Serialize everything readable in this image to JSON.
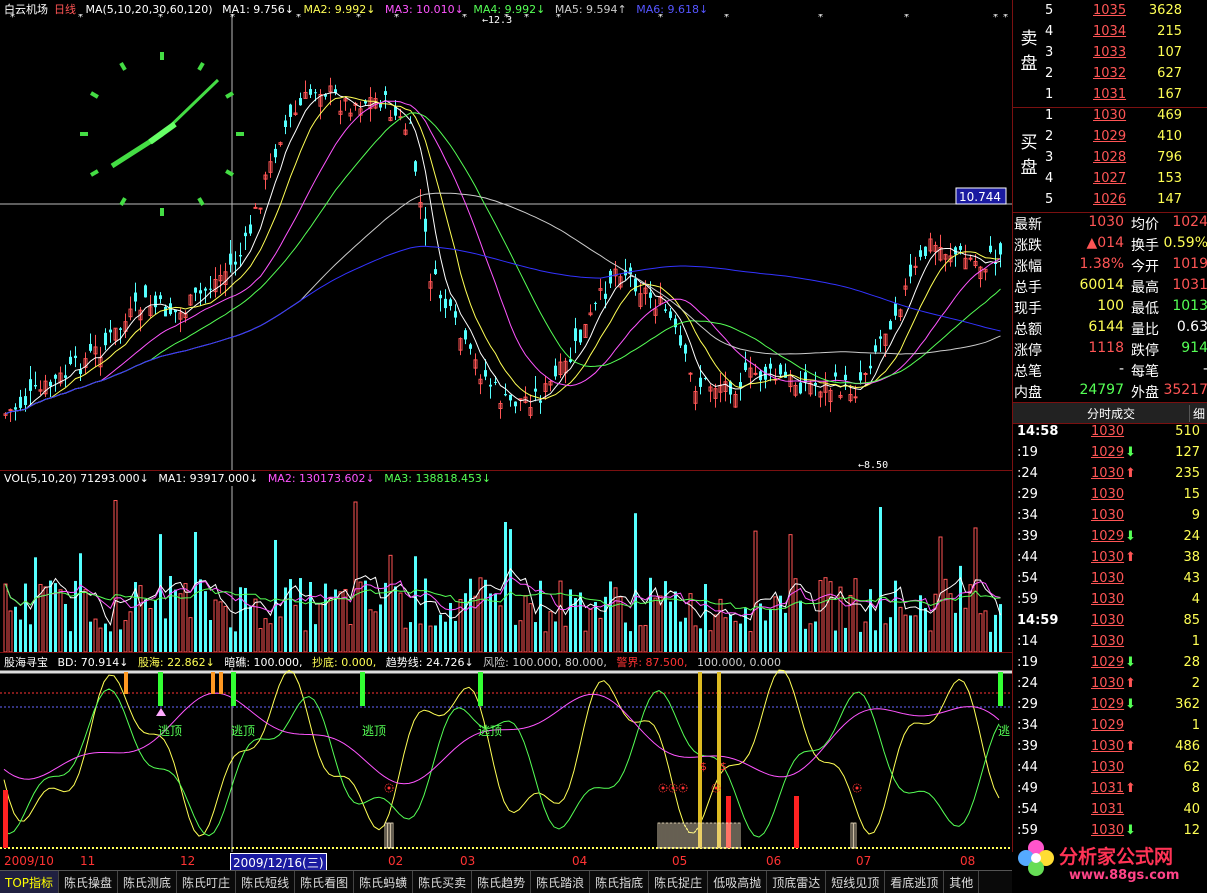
{
  "stock": {
    "name": "白云机场",
    "period": "日线"
  },
  "ma_header": {
    "prefix": "MA(5,10,20,30,60,120)",
    "ma1": "MA1: 9.756↓",
    "ma2": "MA2: 9.992↓",
    "ma3": "MA3: 10.010↓",
    "ma4": "MA4: 9.992↓",
    "ma5": "MA5: 9.594↑",
    "ma6": "MA6: 9.618↓"
  },
  "price_labels": {
    "high": "12.3",
    "low": "8.50",
    "cursor": "10.744"
  },
  "vol_header": {
    "prefix": "VOL(5,10,20) 71293.000↓",
    "ma1": "MA1: 93917.000↓",
    "ma2": "MA2: 130173.602↓",
    "ma3": "MA3: 138818.453↓"
  },
  "ind_header": {
    "name": "股海寻宝",
    "bd": "BD: 70.914↓",
    "gh": "股海: 22.862↓",
    "aj": "暗礁: 100.000,",
    "cd": "抄底: 0.000,",
    "qs": "趋势线: 24.726↓",
    "fx": "风险: 100.000, 80.000,",
    "jj": "警界: 87.500,",
    "rest": "100.000, 0.000"
  },
  "escape_labels": [
    "逃顶",
    "逃顶",
    "逃顶",
    "逃顶",
    "逃"
  ],
  "date_axis": [
    "2009/10",
    "11",
    "12",
    "02",
    "03",
    "04",
    "05",
    "06",
    "07",
    "08"
  ],
  "date_cursor": "2009/12/16(三)",
  "tabs": [
    "TOP指标",
    "陈氏操盘",
    "陈氏测底",
    "陈氏叮庄",
    "陈氏短线",
    "陈氏看图",
    "陈氏蚂蟥",
    "陈氏买卖",
    "陈氏趋势",
    "陈氏踏浪",
    "陈氏指底",
    "陈氏捉庄",
    "低吸高抛",
    "顶底雷达",
    "短线见顶",
    "看底逃顶",
    "其他"
  ],
  "orderbook": {
    "sell_side": "卖盘",
    "buy_side": "买盘",
    "sell": [
      {
        "lv": "5",
        "price": "1035",
        "vol": "3628"
      },
      {
        "lv": "4",
        "price": "1034",
        "vol": "215"
      },
      {
        "lv": "3",
        "price": "1033",
        "vol": "107"
      },
      {
        "lv": "2",
        "price": "1032",
        "vol": "627"
      },
      {
        "lv": "1",
        "price": "1031",
        "vol": "167"
      }
    ],
    "buy": [
      {
        "lv": "1",
        "price": "1030",
        "vol": "469"
      },
      {
        "lv": "2",
        "price": "1029",
        "vol": "410"
      },
      {
        "lv": "3",
        "price": "1028",
        "vol": "796"
      },
      {
        "lv": "4",
        "price": "1027",
        "vol": "153"
      },
      {
        "lv": "5",
        "price": "1026",
        "vol": "147"
      }
    ]
  },
  "quote": [
    {
      "k1": "最新",
      "v1": "1030",
      "c1": "up",
      "k2": "均价",
      "v2": "1024",
      "c2": "up"
    },
    {
      "k1": "涨跌",
      "v1": "▲014",
      "c1": "up",
      "k2": "换手",
      "v2": "0.59%",
      "c2": "yl"
    },
    {
      "k1": "涨幅",
      "v1": "1.38%",
      "c1": "up",
      "k2": "今开",
      "v2": "1019",
      "c2": "up"
    },
    {
      "k1": "总手",
      "v1": "60014",
      "c1": "yl",
      "k2": "最高",
      "v2": "1031",
      "c2": "up"
    },
    {
      "k1": "现手",
      "v1": "100",
      "c1": "yl",
      "k2": "最低",
      "v2": "1013",
      "c2": "dn"
    },
    {
      "k1": "总额",
      "v1": "6144",
      "c1": "yl",
      "k2": "量比",
      "v2": "0.63",
      "c2": "wh"
    },
    {
      "k1": "涨停",
      "v1": "1118",
      "c1": "up",
      "k2": "跌停",
      "v2": "914",
      "c2": "dn"
    },
    {
      "k1": "总笔",
      "v1": "-",
      "c1": "wh",
      "k2": "每笔",
      "v2": "-",
      "c2": "wh"
    },
    {
      "k1": "内盘",
      "v1": "24797",
      "c1": "dn",
      "k2": "外盘",
      "v2": "35217",
      "c2": "up"
    }
  ],
  "ticks_header": {
    "title": "分时成交",
    "tab": "细"
  },
  "ticks": [
    {
      "t": "14:58",
      "p": "1030",
      "d": "",
      "v": "510"
    },
    {
      "t": ":19",
      "p": "1029",
      "d": "dn",
      "v": "127"
    },
    {
      "t": ":24",
      "p": "1030",
      "d": "up",
      "v": "235"
    },
    {
      "t": ":29",
      "p": "1030",
      "d": "",
      "v": "15"
    },
    {
      "t": ":34",
      "p": "1030",
      "d": "",
      "v": "9"
    },
    {
      "t": ":39",
      "p": "1029",
      "d": "dn",
      "v": "24"
    },
    {
      "t": ":44",
      "p": "1030",
      "d": "up",
      "v": "38"
    },
    {
      "t": ":54",
      "p": "1030",
      "d": "",
      "v": "43"
    },
    {
      "t": ":59",
      "p": "1030",
      "d": "",
      "v": "4"
    },
    {
      "t": "14:59",
      "p": "1030",
      "d": "",
      "v": "85"
    },
    {
      "t": ":14",
      "p": "1030",
      "d": "",
      "v": "1"
    },
    {
      "t": ":19",
      "p": "1029",
      "d": "dn",
      "v": "28"
    },
    {
      "t": ":24",
      "p": "1030",
      "d": "up",
      "v": "2"
    },
    {
      "t": ":29",
      "p": "1029",
      "d": "dn",
      "v": "362"
    },
    {
      "t": ":34",
      "p": "1029",
      "d": "",
      "v": "1"
    },
    {
      "t": ":39",
      "p": "1030",
      "d": "up",
      "v": "486"
    },
    {
      "t": ":44",
      "p": "1030",
      "d": "",
      "v": "62"
    },
    {
      "t": ":49",
      "p": "1031",
      "d": "up",
      "v": "8"
    },
    {
      "t": ":54",
      "p": "1031",
      "d": "",
      "v": "40"
    },
    {
      "t": ":59",
      "p": "1030",
      "d": "dn",
      "v": "12"
    }
  ],
  "watermark": {
    "text": "分析家公式网",
    "url": "www.88gs.com"
  },
  "colors": {
    "up": "#ff5555",
    "down": "#55ffff",
    "ma_white": "#ffffff",
    "ma_yellow": "#ffff55",
    "ma_magenta": "#ff55ff",
    "ma_green": "#55ff55",
    "ma_gray": "#cccccc",
    "ma_blue": "#3333ff"
  }
}
